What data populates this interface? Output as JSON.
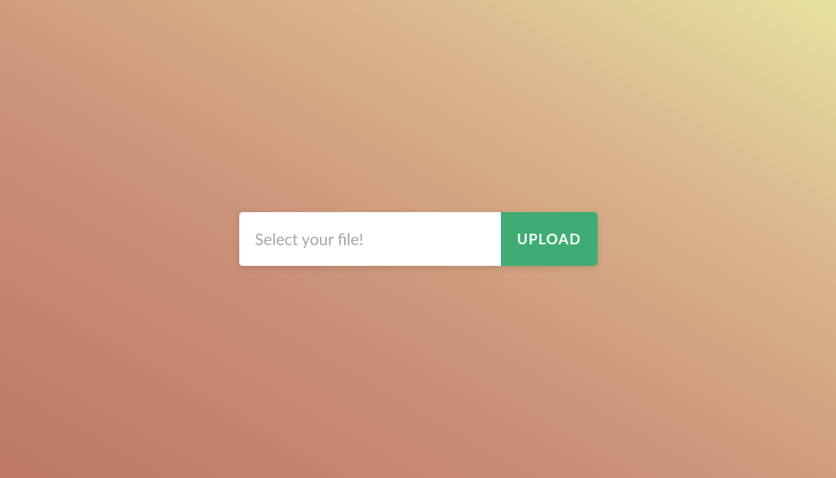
{
  "upload": {
    "placeholder": "Select your file!",
    "button_label": "UPLOAD"
  }
}
